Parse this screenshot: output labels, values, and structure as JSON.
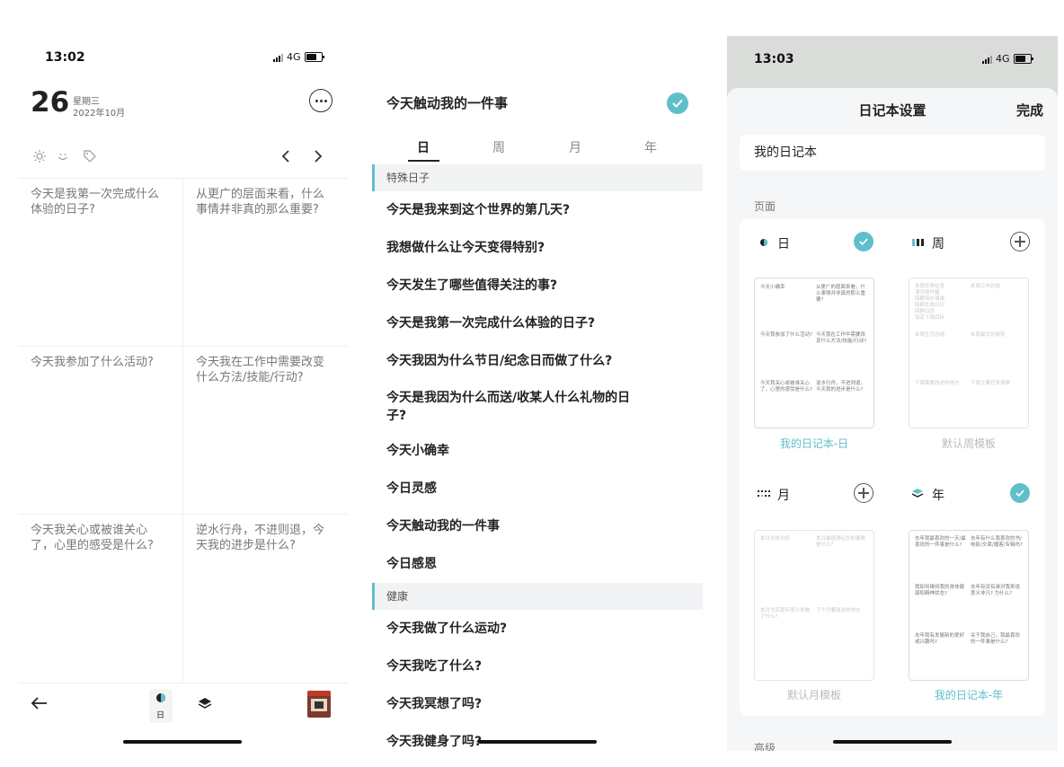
{
  "screen1": {
    "time": "13:02",
    "network": "4G",
    "day": "26",
    "weekday": "星期三",
    "year_month": "2022年10月",
    "icons": [
      "sun-icon",
      "smile-icon",
      "tag-icon",
      "chevron-left-icon",
      "chevron-right-icon"
    ],
    "prompts": [
      "今天是我第一次完成什么体验的日子?",
      "从更广的层面来看，什么事情并非真的那么重要?",
      "今天我参加了什么活动?",
      "今天我在工作中需要改变什么方法/技能/行动?",
      "今天我关心或被谁关心了，心里的感受是什么?",
      "逆水行舟，不进则退，今天我的进步是什么?"
    ],
    "bottom": {
      "day_label": "日"
    }
  },
  "screen2": {
    "title": "今天触动我的一件事",
    "tabs": [
      "日",
      "周",
      "月",
      "年"
    ],
    "sections": [
      {
        "header": "特殊日子",
        "items": [
          "今天是我来到这个世界的第几天?",
          "我想做什么让今天变得特别?",
          "今天发生了哪些值得关注的事?",
          "今天是我第一次完成什么体验的日子?",
          "今天我因为什么节日/纪念日而做了什么?",
          "今天是我因为什么而送/收某人什么礼物的日子?",
          "今天小确幸",
          "今日灵感",
          "今天触动我的一件事",
          "今日感恩"
        ]
      },
      {
        "header": "健康",
        "items": [
          "今天我做了什么运动?",
          "今天我吃了什么?",
          "今天我冥想了吗?",
          "今天我健身了吗?"
        ]
      }
    ],
    "accent": "#5fbfca"
  },
  "screen3": {
    "time": "13:03",
    "network": "4G",
    "title": "日记本设置",
    "done": "完成",
    "notebook_name": "我的日记本",
    "pages_label": "页面",
    "advanced_label": "高级",
    "pages": [
      {
        "name": "日",
        "selected": true,
        "label": "我的日记本-日",
        "thumb": [
          "今天小确幸",
          "从更广的层面来看，什么事情并非真的那么重要?",
          "今天我参加了什么活动?",
          "今天我在工作中需要改变什么方法/技能/行动?",
          "今天我关心或被谁关心了，心里的感受是什么?",
          "逆水行舟，不进则退，今天我的进步是什么?"
        ]
      },
      {
        "name": "周",
        "selected": false,
        "label": "默认周模板",
        "thumb": [
          "本周任务检查",
          "本周工作总结",
          "本周生活总结",
          "本周最大的收获",
          "下周需要改进的地方",
          "下周主要任务清单"
        ],
        "checklist": [
          "清空收件箱",
          "回顾待办清单",
          "回顾本周日记",
          "回顾日历",
          "设定下周目标"
        ]
      },
      {
        "name": "月",
        "selected": false,
        "label": "默认月模板",
        "thumb": [
          "本月总体分析",
          "本月最值得纪念的事情是什么?",
          "本月为实现年度计划做了什么?",
          "下个月要改进的地方"
        ]
      },
      {
        "name": "年",
        "selected": true,
        "label": "我的日记本-年",
        "thumb": [
          "去年我最喜欢的一天/最喜欢的一件事是什么?",
          "去年有什么我喜欢的书/电影/文章/播客/专辑吗?",
          "我如何维持我的身体健康和精神状态?",
          "去年有没有谁对我来说意义非凡? 为什么?",
          "去年我有发展新的爱好或兴趣吗?",
          "关于我自己，我最喜欢的一件事是什么?"
        ]
      }
    ]
  }
}
